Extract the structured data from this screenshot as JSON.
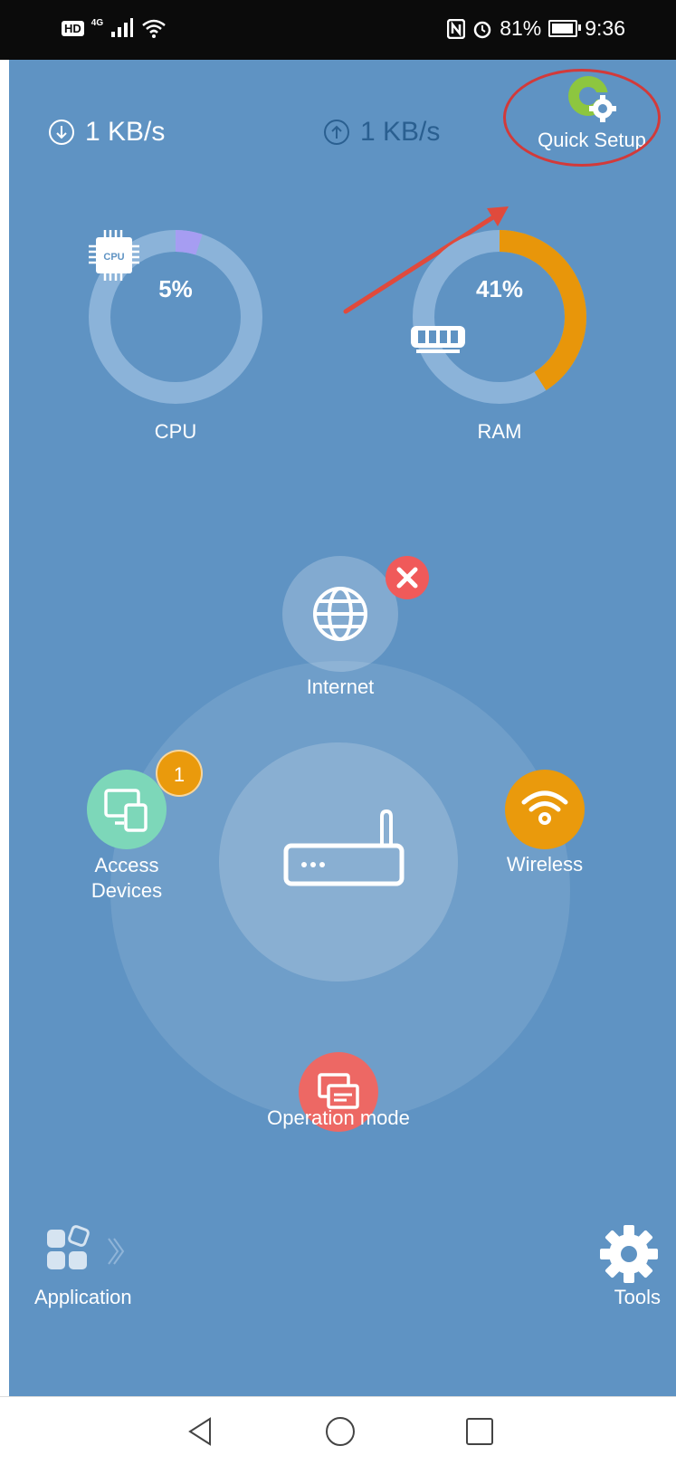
{
  "status_bar": {
    "left_badge": "HD",
    "network": "4G",
    "battery": "81%",
    "time": "9:36"
  },
  "header": {
    "download_speed": "1 KB/s",
    "upload_speed": "1 KB/s",
    "quick_setup_label": "Quick Setup"
  },
  "gauges": {
    "cpu": {
      "label": "CPU",
      "value_text": "5%",
      "percent": 5,
      "color": "#a69df2",
      "chip_text": "CPU"
    },
    "ram": {
      "label": "RAM",
      "value_text": "41%",
      "percent": 41,
      "color": "#e8960a"
    }
  },
  "network_map": {
    "internet": {
      "label": "Internet",
      "status_color": "#f05a5a"
    },
    "access_devices": {
      "label_line1": "Access",
      "label_line2": "Devices",
      "badge": "1",
      "color": "#7dd7b9"
    },
    "wireless": {
      "label": "Wireless",
      "color": "#ea9a0c"
    },
    "operation_mode": {
      "label": "Operation mode",
      "color": "#ed6864"
    }
  },
  "bottom": {
    "application_label": "Application",
    "tools_label": "Tools"
  },
  "colors": {
    "background": "#5f93c3",
    "annotation_red": "#d23a3a",
    "gauge_track": "#8bb3d9"
  },
  "icons": [
    "download-icon",
    "upload-icon",
    "quick-setup-logo-icon",
    "cpu-chip-icon",
    "memory-icon",
    "globe-icon",
    "error-x-icon",
    "devices-icon",
    "wifi-icon",
    "router-icon",
    "operation-mode-icon",
    "application-grid-icon",
    "gear-icon",
    "back-icon",
    "home-icon",
    "recents-icon"
  ]
}
